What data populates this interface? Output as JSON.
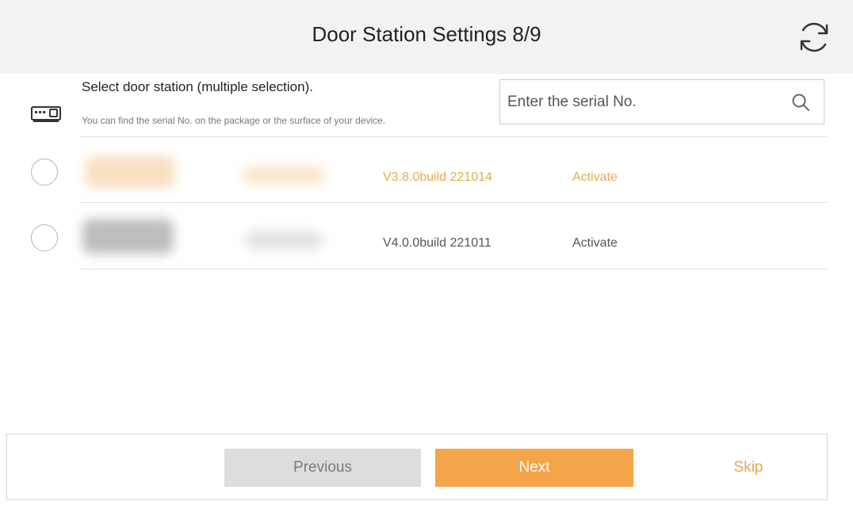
{
  "header": {
    "title": "Door Station Settings 8/9",
    "refresh_icon": "refresh-icon"
  },
  "selection": {
    "device_icon": "door-station-icon",
    "prompt": "Select door station (multiple selection).",
    "hint": "You can find the serial No. on the package or the surface of your device."
  },
  "search": {
    "placeholder": "Enter the serial No.",
    "icon": "search-icon"
  },
  "devices": [
    {
      "firmware": "V3.8.0build 221014",
      "status": "Activate",
      "selected": false,
      "color": "#e8a94e"
    },
    {
      "firmware": "V4.0.0build 221011",
      "status": "Activate",
      "selected": false,
      "color": "#555555"
    }
  ],
  "footer": {
    "previous_label": "Previous",
    "next_label": "Next",
    "skip_label": "Skip"
  },
  "colors": {
    "accent": "#f4a549",
    "header_bg": "#f2f2f2",
    "disabled_button": "#dddddd"
  }
}
